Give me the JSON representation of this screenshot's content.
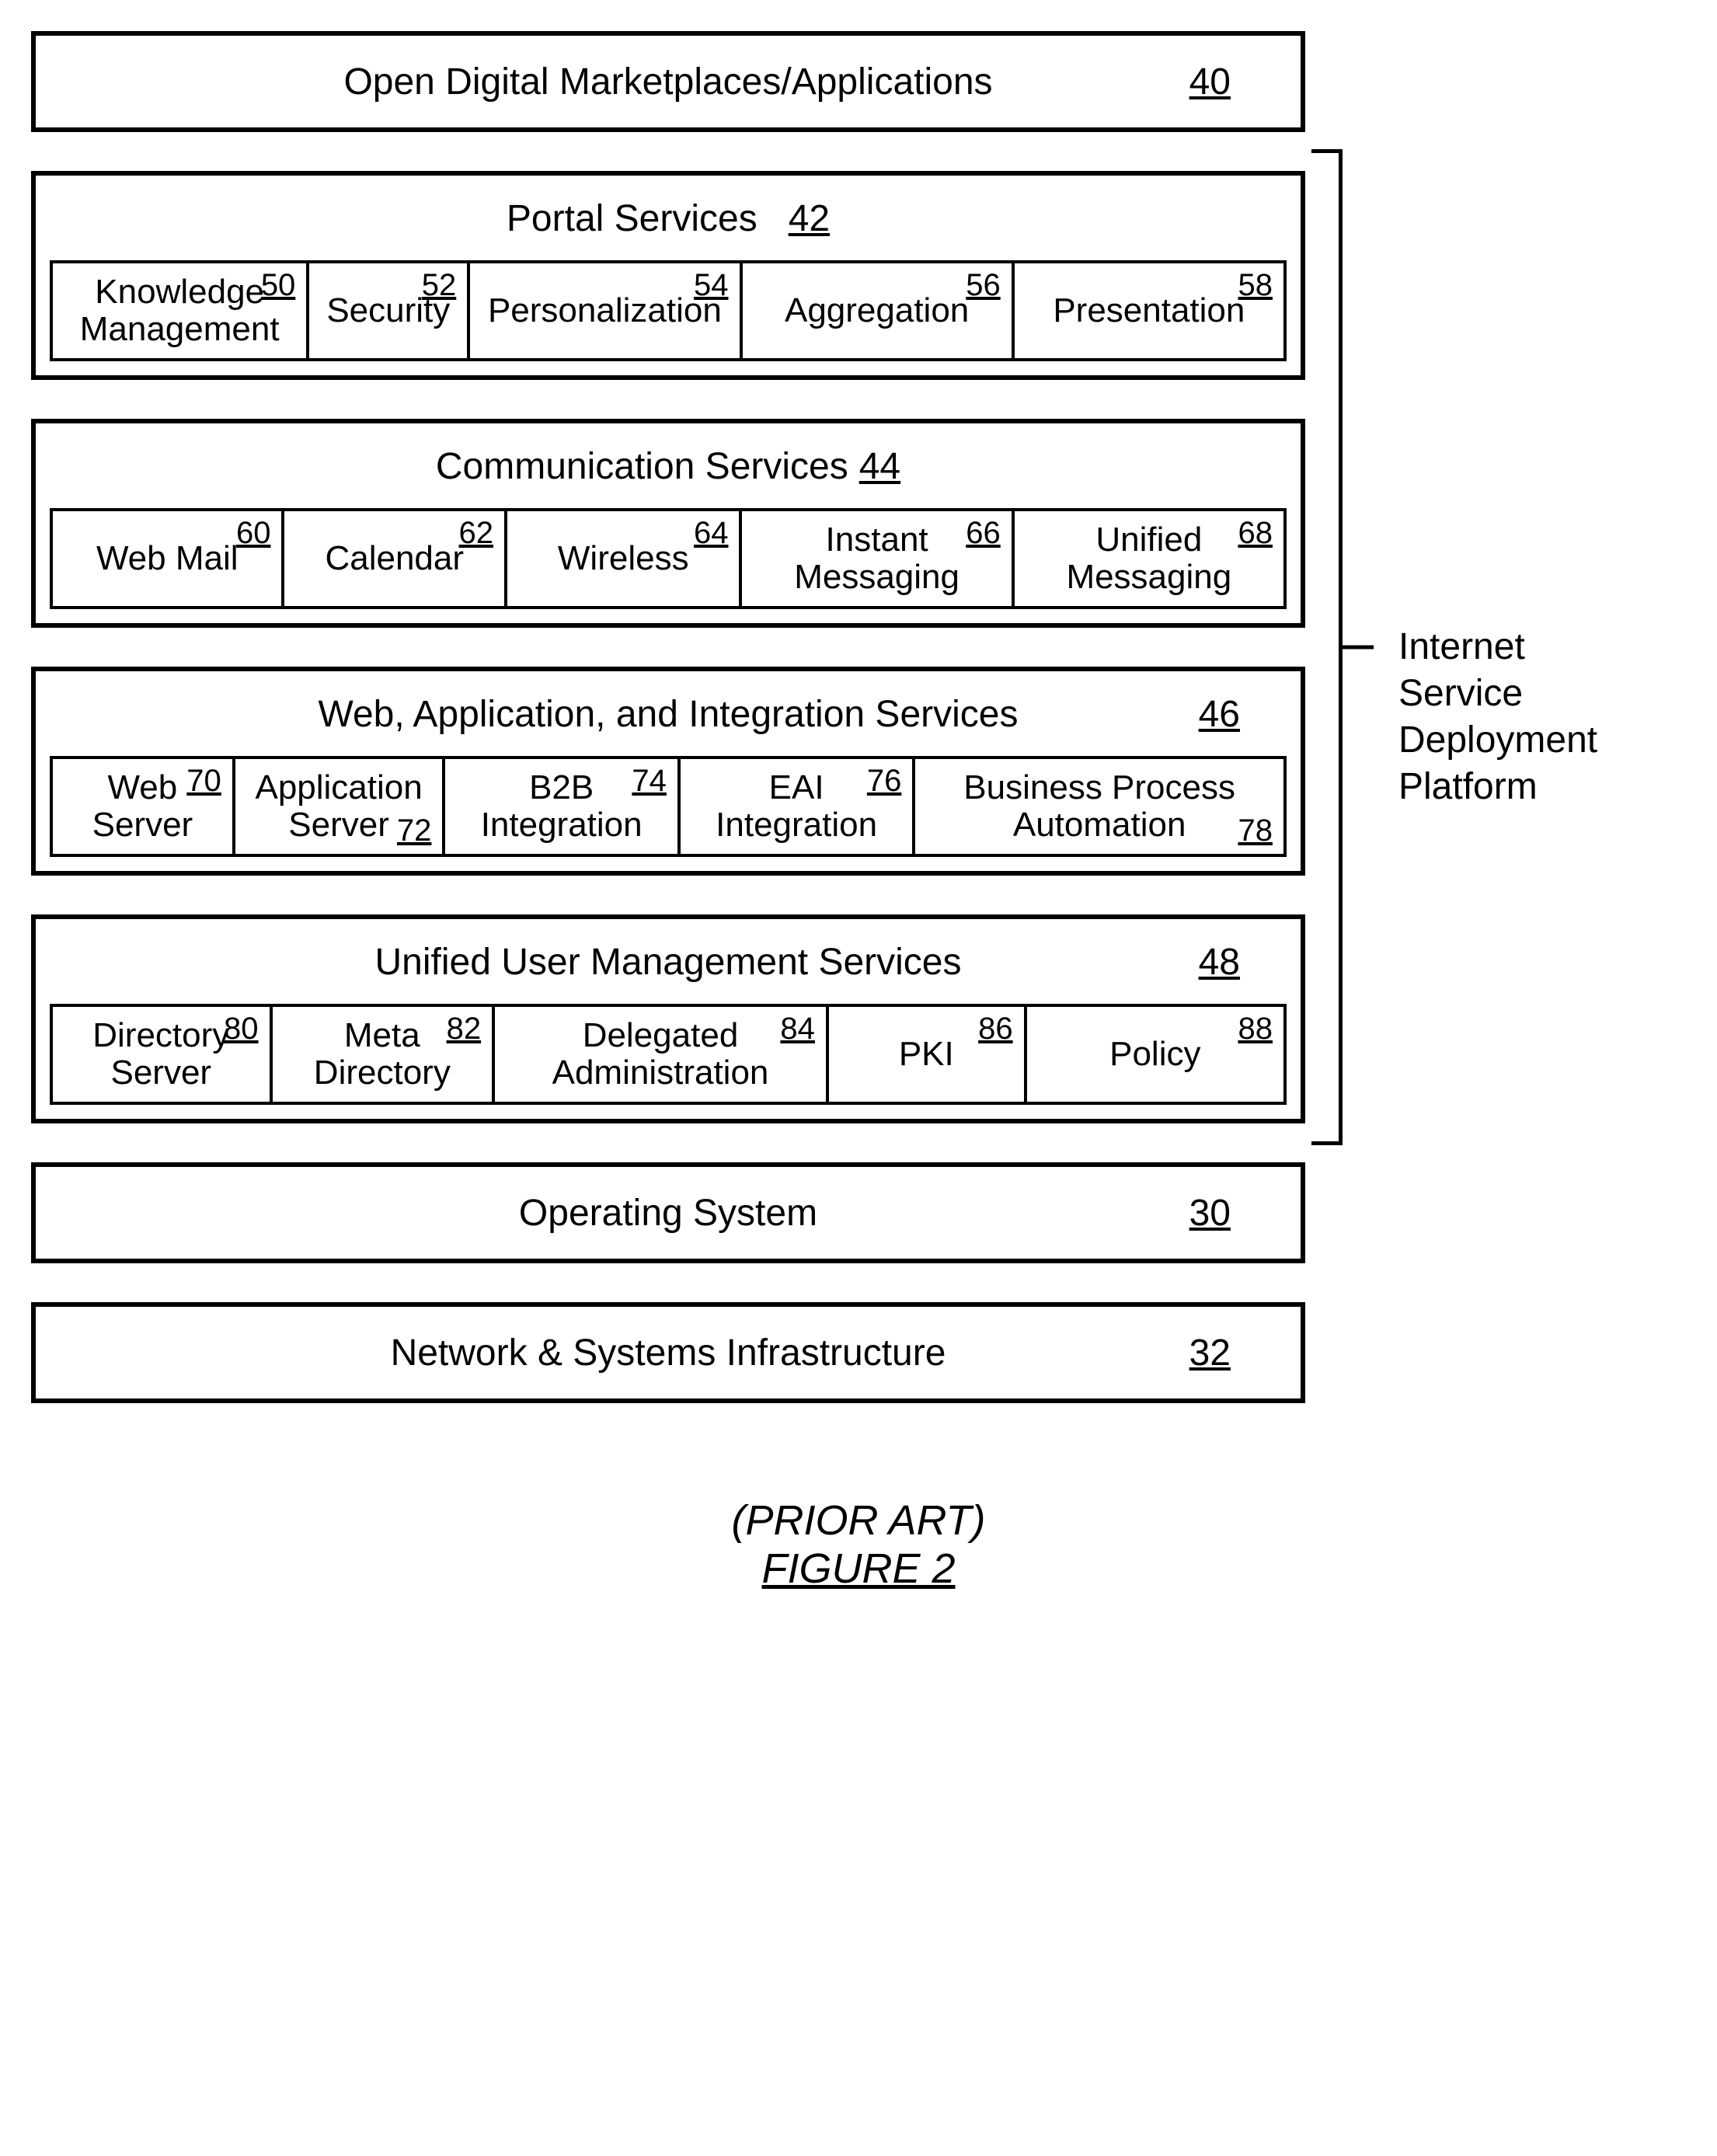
{
  "top_box": {
    "label": "Open Digital Marketplaces/Applications",
    "ref": "40"
  },
  "platform_label": "Internet\nService\nDeployment\nPlatform",
  "portal": {
    "title": "Portal Services",
    "ref": "42",
    "cells": [
      {
        "label": "Knowledge\nManagement",
        "ref": "50"
      },
      {
        "label": "Security",
        "ref": "52"
      },
      {
        "label": "Personalization",
        "ref": "54"
      },
      {
        "label": "Aggregation",
        "ref": "56"
      },
      {
        "label": "Presentation",
        "ref": "58"
      }
    ]
  },
  "comm": {
    "title": "Communication Services",
    "ref": "44",
    "cells": [
      {
        "label": "Web Mail",
        "ref": "60"
      },
      {
        "label": "Calendar",
        "ref": "62"
      },
      {
        "label": "Wireless",
        "ref": "64"
      },
      {
        "label": "Instant\nMessaging",
        "ref": "66"
      },
      {
        "label": "Unified\nMessaging",
        "ref": "68"
      }
    ]
  },
  "web": {
    "title": "Web, Application, and Integration Services",
    "ref": "46",
    "cells": [
      {
        "label": "Web\nServer",
        "ref": "70"
      },
      {
        "label": "Application\nServer",
        "ref": "72"
      },
      {
        "label": "B2B\nIntegration",
        "ref": "74"
      },
      {
        "label": "EAI\nIntegration",
        "ref": "76"
      },
      {
        "label": "Business Process\nAutomation",
        "ref": "78"
      }
    ]
  },
  "uum": {
    "title": "Unified User Management Services",
    "ref": "48",
    "cells": [
      {
        "label": "Directory\nServer",
        "ref": "80"
      },
      {
        "label": "Meta\nDirectory",
        "ref": "82"
      },
      {
        "label": "Delegated\nAdministration",
        "ref": "84"
      },
      {
        "label": "PKI",
        "ref": "86"
      },
      {
        "label": "Policy",
        "ref": "88"
      }
    ]
  },
  "os_box": {
    "label": "Operating System",
    "ref": "30"
  },
  "infra_box": {
    "label": "Network & Systems Infrastructure",
    "ref": "32"
  },
  "caption_prior": "(PRIOR ART)",
  "caption_fig": "FIGURE 2"
}
